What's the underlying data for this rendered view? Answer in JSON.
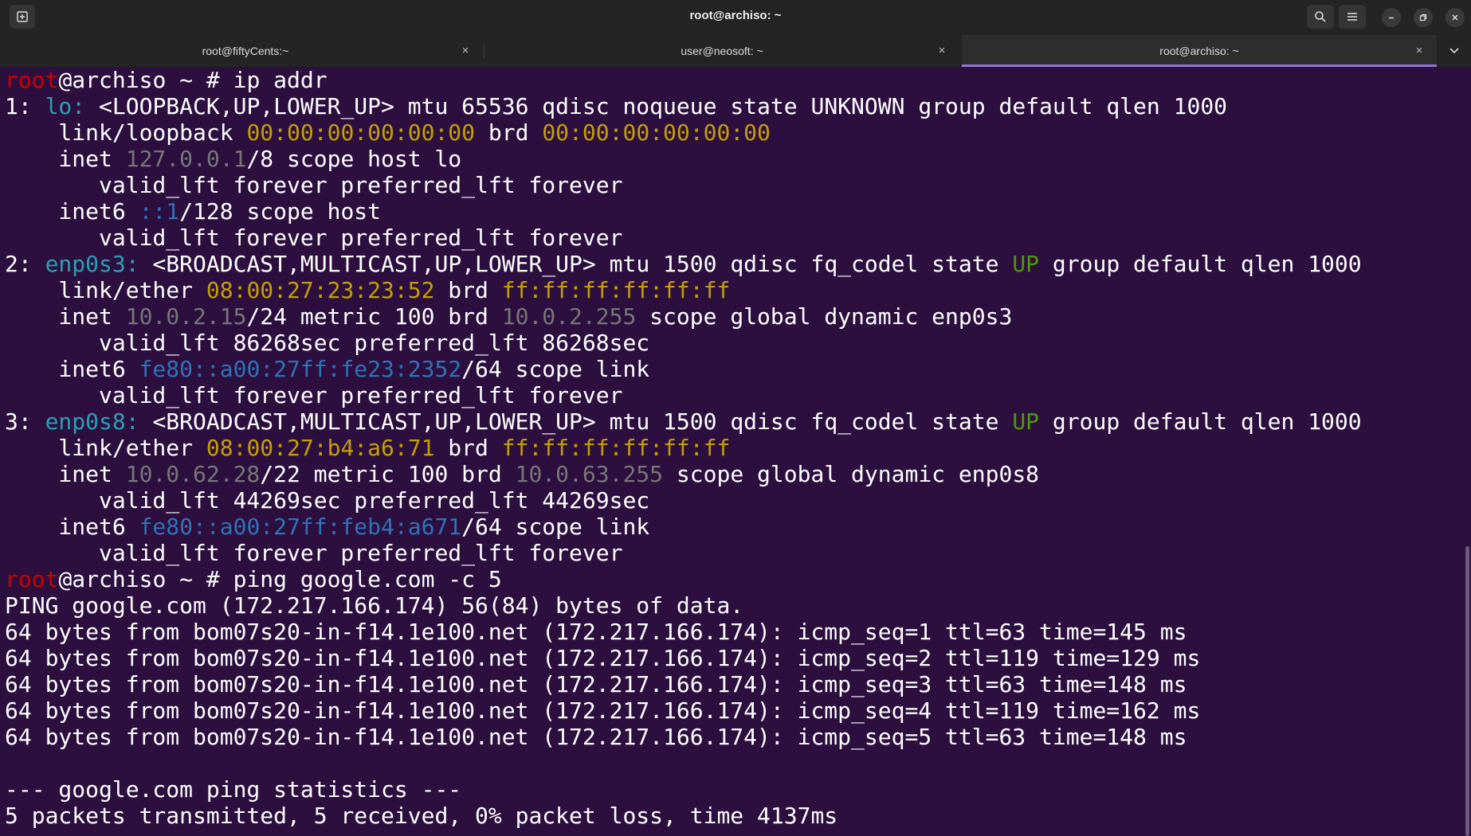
{
  "window": {
    "title": "root@archiso: ~"
  },
  "tabs": [
    {
      "label": "root@fiftyCents:~",
      "active": false
    },
    {
      "label": "user@neosoft: ~",
      "active": false
    },
    {
      "label": "root@archiso: ~",
      "active": true
    }
  ],
  "colors": {
    "background": "#2c0f3f",
    "prompt_user": "#cc0000",
    "interface": "#2aa1b3",
    "mac": "#c4a000",
    "ipv4": "#777777",
    "ipv6": "#2f73b7",
    "state_up": "#4e9a06",
    "tab_indicator": "#8f74d9"
  },
  "terminal": {
    "lines": [
      [
        {
          "t": "root",
          "c": "r"
        },
        {
          "t": "@archiso ~ # ip addr"
        }
      ],
      [
        {
          "t": "1: "
        },
        {
          "t": "lo:",
          "c": "c"
        },
        {
          "t": " <LOOPBACK,UP,LOWER_UP> mtu 65536 qdisc noqueue state UNKNOWN group default qlen 1000"
        }
      ],
      [
        {
          "t": "    link/loopback "
        },
        {
          "t": "00:00:00:00:00:00",
          "c": "y"
        },
        {
          "t": " brd "
        },
        {
          "t": "00:00:00:00:00:00",
          "c": "y"
        }
      ],
      [
        {
          "t": "    inet "
        },
        {
          "t": "127.0.0.1",
          "c": "g"
        },
        {
          "t": "/8 scope host lo"
        }
      ],
      [
        {
          "t": "       valid_lft forever preferred_lft forever"
        }
      ],
      [
        {
          "t": "    inet6 "
        },
        {
          "t": "::1",
          "c": "b"
        },
        {
          "t": "/128 scope host"
        }
      ],
      [
        {
          "t": "       valid_lft forever preferred_lft forever"
        }
      ],
      [
        {
          "t": "2: "
        },
        {
          "t": "enp0s3:",
          "c": "c"
        },
        {
          "t": " <BROADCAST,MULTICAST,UP,LOWER_UP> mtu 1500 qdisc fq_codel state "
        },
        {
          "t": "UP",
          "c": "gr"
        },
        {
          "t": " group default qlen 1000"
        }
      ],
      [
        {
          "t": "    link/ether "
        },
        {
          "t": "08:00:27:23:23:52",
          "c": "y"
        },
        {
          "t": " brd "
        },
        {
          "t": "ff:ff:ff:ff:ff:ff",
          "c": "y"
        }
      ],
      [
        {
          "t": "    inet "
        },
        {
          "t": "10.0.2.15",
          "c": "g"
        },
        {
          "t": "/24 metric 100 brd "
        },
        {
          "t": "10.0.2.255",
          "c": "g"
        },
        {
          "t": " scope global dynamic enp0s3"
        }
      ],
      [
        {
          "t": "       valid_lft 86268sec preferred_lft 86268sec"
        }
      ],
      [
        {
          "t": "    inet6 "
        },
        {
          "t": "fe80::a00:27ff:fe23:2352",
          "c": "b"
        },
        {
          "t": "/64 scope link"
        }
      ],
      [
        {
          "t": "       valid_lft forever preferred_lft forever"
        }
      ],
      [
        {
          "t": "3: "
        },
        {
          "t": "enp0s8:",
          "c": "c"
        },
        {
          "t": " <BROADCAST,MULTICAST,UP,LOWER_UP> mtu 1500 qdisc fq_codel state "
        },
        {
          "t": "UP",
          "c": "gr"
        },
        {
          "t": " group default qlen 1000"
        }
      ],
      [
        {
          "t": "    link/ether "
        },
        {
          "t": "08:00:27:b4:a6:71",
          "c": "y"
        },
        {
          "t": " brd "
        },
        {
          "t": "ff:ff:ff:ff:ff:ff",
          "c": "y"
        }
      ],
      [
        {
          "t": "    inet "
        },
        {
          "t": "10.0.62.28",
          "c": "g"
        },
        {
          "t": "/22 metric 100 brd "
        },
        {
          "t": "10.0.63.255",
          "c": "g"
        },
        {
          "t": " scope global dynamic enp0s8"
        }
      ],
      [
        {
          "t": "       valid_lft 44269sec preferred_lft 44269sec"
        }
      ],
      [
        {
          "t": "    inet6 "
        },
        {
          "t": "fe80::a00:27ff:feb4:a671",
          "c": "b"
        },
        {
          "t": "/64 scope link"
        }
      ],
      [
        {
          "t": "       valid_lft forever preferred_lft forever"
        }
      ],
      [
        {
          "t": "root",
          "c": "r"
        },
        {
          "t": "@archiso ~ # ping google.com -c 5"
        }
      ],
      [
        {
          "t": "PING google.com (172.217.166.174) 56(84) bytes of data."
        }
      ],
      [
        {
          "t": "64 bytes from bom07s20-in-f14.1e100.net (172.217.166.174): icmp_seq=1 ttl=63 time=145 ms"
        }
      ],
      [
        {
          "t": "64 bytes from bom07s20-in-f14.1e100.net (172.217.166.174): icmp_seq=2 ttl=119 time=129 ms"
        }
      ],
      [
        {
          "t": "64 bytes from bom07s20-in-f14.1e100.net (172.217.166.174): icmp_seq=3 ttl=63 time=148 ms"
        }
      ],
      [
        {
          "t": "64 bytes from bom07s20-in-f14.1e100.net (172.217.166.174): icmp_seq=4 ttl=119 time=162 ms"
        }
      ],
      [
        {
          "t": "64 bytes from bom07s20-in-f14.1e100.net (172.217.166.174): icmp_seq=5 ttl=63 time=148 ms"
        }
      ],
      [
        {
          "t": ""
        }
      ],
      [
        {
          "t": "--- google.com ping statistics ---"
        }
      ],
      [
        {
          "t": "5 packets transmitted, 5 received, 0% packet loss, time 4137ms"
        }
      ]
    ]
  }
}
